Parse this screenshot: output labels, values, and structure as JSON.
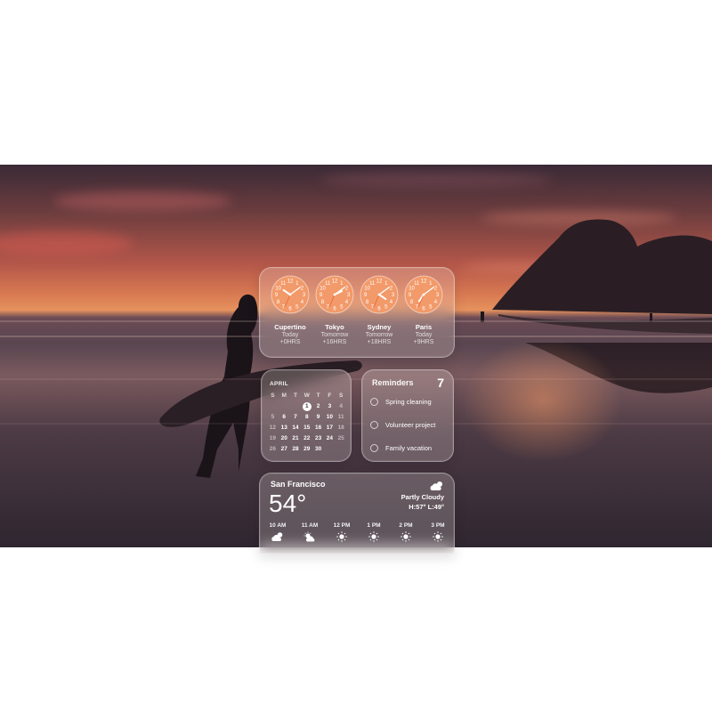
{
  "clocks": [
    {
      "city": "Cupertino",
      "day": "Today",
      "offset": "+0HRS",
      "hour": 10,
      "minute": 9
    },
    {
      "city": "Tokyo",
      "day": "Tomorrow",
      "offset": "+16HRS",
      "hour": 2,
      "minute": 9
    },
    {
      "city": "Sydney",
      "day": "Tomorrow",
      "offset": "+18HRS",
      "hour": 4,
      "minute": 9
    },
    {
      "city": "Paris",
      "day": "Today",
      "offset": "+9HRS",
      "hour": 7,
      "minute": 9
    }
  ],
  "calendar": {
    "month": "APRIL",
    "weekdays": [
      "S",
      "M",
      "T",
      "W",
      "T",
      "F",
      "S"
    ],
    "weeks": [
      [
        "",
        "",
        "",
        "1",
        "2",
        "3",
        "4"
      ],
      [
        "5",
        "6",
        "7",
        "8",
        "9",
        "10",
        "11"
      ],
      [
        "12",
        "13",
        "14",
        "15",
        "16",
        "17",
        "18"
      ],
      [
        "19",
        "20",
        "21",
        "22",
        "23",
        "24",
        "25"
      ],
      [
        "26",
        "27",
        "28",
        "29",
        "30",
        "",
        ""
      ]
    ],
    "today": "1"
  },
  "reminders": {
    "title": "Reminders",
    "count": "7",
    "items": [
      "Spring cleaning",
      "Volunteer project",
      "Family vacation"
    ]
  },
  "weather": {
    "city": "San Francisco",
    "temp": "54°",
    "condition": "Partly Cloudy",
    "condition_icon": "partly-cloudy-icon",
    "hilo": "H:57° L:49°",
    "hours": [
      {
        "label": "10 AM",
        "icon": "partly-cloudy-icon"
      },
      {
        "label": "11 AM",
        "icon": "partly-sunny-icon"
      },
      {
        "label": "12 PM",
        "icon": "sun-icon"
      },
      {
        "label": "1 PM",
        "icon": "sun-icon"
      },
      {
        "label": "2 PM",
        "icon": "sun-icon"
      },
      {
        "label": "3 PM",
        "icon": "sun-icon"
      }
    ]
  }
}
